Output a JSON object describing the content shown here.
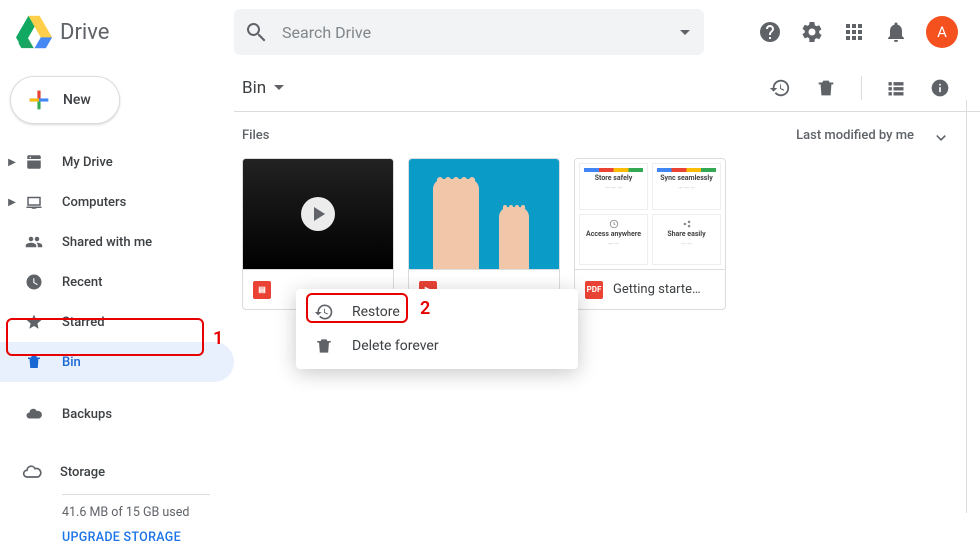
{
  "app_name": "Drive",
  "search": {
    "placeholder": "Search Drive"
  },
  "avatar_initial": "A",
  "new_button": "New",
  "sidebar": {
    "items": [
      {
        "label": "My Drive"
      },
      {
        "label": "Computers"
      },
      {
        "label": "Shared with me"
      },
      {
        "label": "Recent"
      },
      {
        "label": "Starred"
      },
      {
        "label": "Bin"
      },
      {
        "label": "Backups"
      }
    ],
    "storage": {
      "label": "Storage",
      "used_line": "41.6 MB of 15 GB used",
      "upgrade": "UPGRADE STORAGE"
    }
  },
  "location": {
    "title": "Bin"
  },
  "section_label": "Files",
  "sort_label": "Last modified by me",
  "files": [
    {
      "name": "",
      "type": "video"
    },
    {
      "name": "",
      "type": "image"
    },
    {
      "name": "Getting starte…",
      "type": "pdf",
      "badge": "PDF"
    }
  ],
  "doc_thumb": {
    "cells": [
      {
        "title": "Store safely"
      },
      {
        "title": "Sync seamlessly"
      },
      {
        "title": "Access anywhere"
      },
      {
        "title": "Share easily"
      }
    ]
  },
  "context_menu": {
    "restore": "Restore",
    "delete": "Delete forever"
  },
  "annotations": {
    "one": "1",
    "two": "2"
  }
}
